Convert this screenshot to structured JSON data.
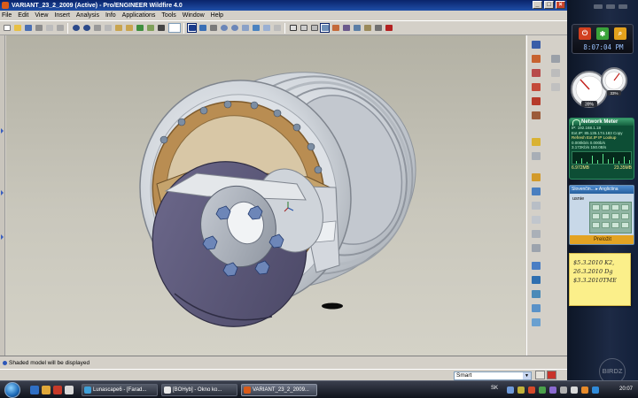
{
  "window": {
    "title": "VARIANT_23_2_2009 (Active) - Pro/ENGINEER Wildfire 4.0"
  },
  "menu": [
    "File",
    "Edit",
    "View",
    "Insert",
    "Analysis",
    "Info",
    "Applications",
    "Tools",
    "Window",
    "Help"
  ],
  "status": {
    "message": "Shaded model will be displayed",
    "filter": "Smart"
  },
  "sidebar": {
    "clock": "8:07:04 PM",
    "cpu": {
      "left_percent": "39%",
      "right_percent": "33%"
    },
    "network": {
      "title": "Network Meter",
      "lines": [
        "IP: 192.168.1.18",
        "Ext.IP: 85.135.174.183   Copy",
        "Refresh Ext.IP    IP Lookup",
        "0.000kb/s   0.000b/s",
        "3.172Kb/s   150.0B/s"
      ],
      "total_in": "6.972MB",
      "total_out": "23.35MB"
    },
    "translator": {
      "header": "Slovenčin... ▸ Anglictina",
      "word": "usnie",
      "button": "Preložit"
    },
    "note": [
      "$5.3.2010 K2,",
      "26.3.2010 Dg",
      "$3.3.2010TME"
    ],
    "watermark": "BIRDZ"
  },
  "taskbar": {
    "tasks": [
      "Lunascape6 - [Farad...",
      "[BOHyb] - Okno ko...",
      "VARIANT_23_2_2009..."
    ],
    "lang": "SK",
    "time": "20:07"
  },
  "colors": {
    "title_bar": "#0a246a",
    "viewport_bg": "#c3c1b5",
    "rotor": "#5b5877",
    "rim": "#d9dee4",
    "flange": "#b98d52"
  }
}
